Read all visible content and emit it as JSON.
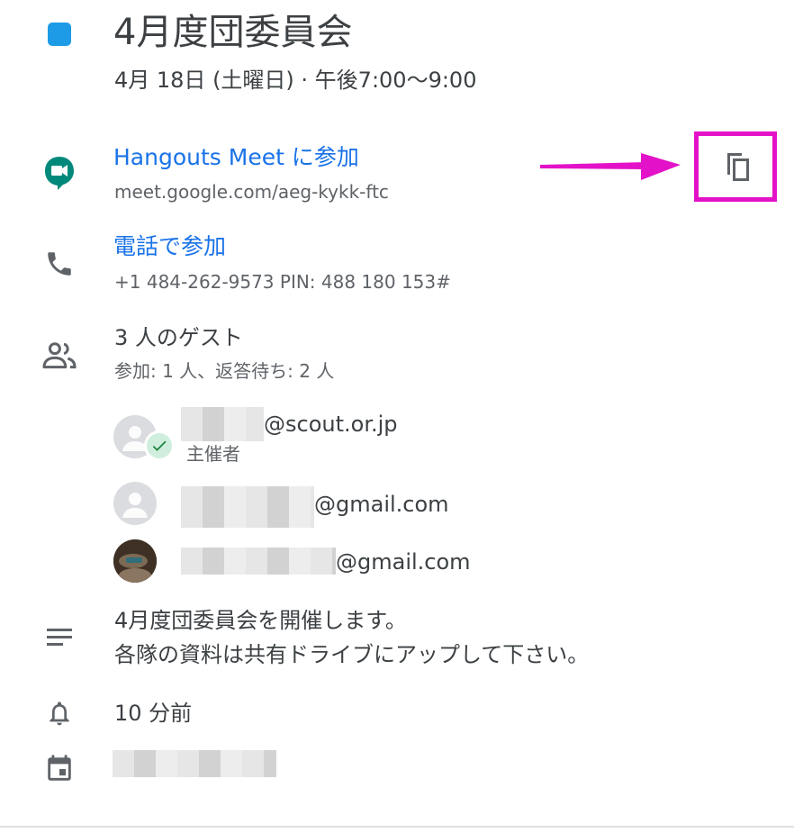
{
  "event": {
    "title": "4月度団委員会",
    "datetime": "4月 18日 (土曜日)  ·  午後7:00〜9:00",
    "color": "#1e9be6"
  },
  "meet": {
    "label": "Hangouts Meet に参加",
    "url": "meet.google.com/aeg-kykk-ftc",
    "icon": "hangouts-meet-icon"
  },
  "phone": {
    "label": "電話で参加",
    "detail": "+1 484-262-9573 PIN: 488 180 153#",
    "icon": "phone-icon"
  },
  "copy": {
    "icon": "copy-icon",
    "highlight_color": "#e312c8"
  },
  "guests": {
    "title": "3 人のゲスト",
    "summary": "参加: 1 人、返答待ち: 2 人",
    "list": [
      {
        "email_suffix": "@scout.or.jp",
        "role": "主催者"
      },
      {
        "email_suffix": "@gmail.com",
        "role": ""
      },
      {
        "email_suffix": "@gmail.com",
        "role": ""
      }
    ]
  },
  "description": {
    "line1": "4月度団委員会を開催します。",
    "line2": "各隊の資料は共有ドライブにアップして下さい。"
  },
  "reminder": {
    "text": "10 分前"
  }
}
